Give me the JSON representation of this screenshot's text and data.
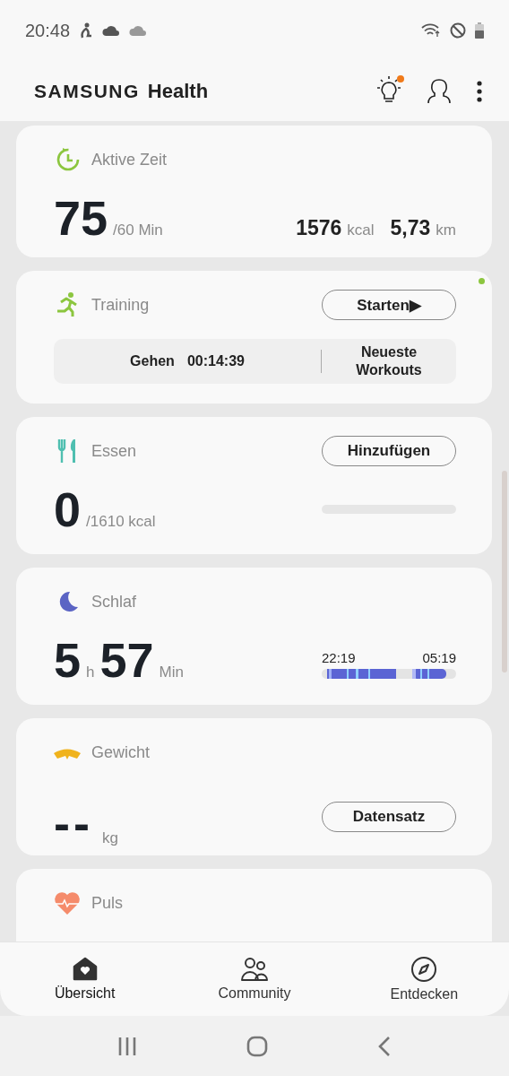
{
  "status_bar": {
    "time": "20:48"
  },
  "header": {
    "brand": "SAMSUNG",
    "app": "Health",
    "tips_badge": true
  },
  "cards": [
    {
      "kind": "active",
      "title": "Aktive Zeit",
      "value": "75",
      "goal": "/60 Min",
      "stats": [
        {
          "value": "1576",
          "unit": "kcal"
        },
        {
          "value": "5,73",
          "unit": "km"
        }
      ]
    },
    {
      "kind": "training",
      "title": "Training",
      "button": "Starten▶",
      "new_badge": true,
      "activity": "Gehen",
      "duration": "00:14:39",
      "link": "Neueste Workouts"
    },
    {
      "kind": "food",
      "title": "Essen",
      "button": "Hinzufügen",
      "value": "0",
      "goal": "/1610 kcal",
      "level": 0
    },
    {
      "kind": "sleep",
      "title": "Schlaf",
      "hours": "5",
      "hours_unit": "h",
      "minutes": "57",
      "minutes_unit": "Min",
      "start": "22:19",
      "end": "05:19"
    },
    {
      "kind": "weight",
      "title": "Gewicht",
      "value": "--",
      "unit": "kg",
      "button": "Datensatz"
    },
    {
      "kind": "pulse",
      "title": "Puls"
    }
  ],
  "nav": [
    {
      "label": "Übersicht",
      "selected": true
    },
    {
      "label": "Community",
      "selected": false
    },
    {
      "label": "Entdecken",
      "selected": false
    }
  ]
}
